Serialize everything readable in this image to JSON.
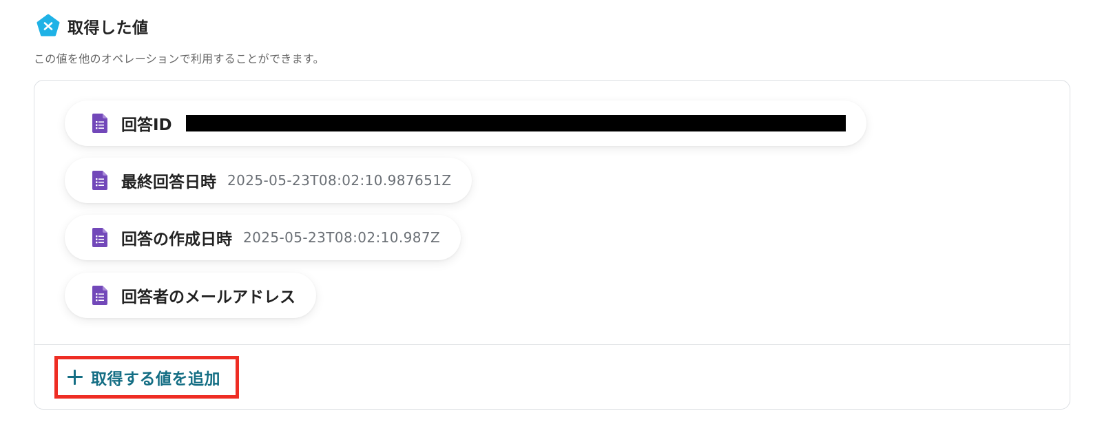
{
  "header": {
    "title": "取得した値",
    "icon": "variable-icon",
    "icon_color": "#1fb2e6"
  },
  "description": "この値を他のオペレーションで利用することができます。",
  "values": [
    {
      "label": "回答ID",
      "value": "",
      "redacted": true,
      "icon": "google-forms-icon"
    },
    {
      "label": "最終回答日時",
      "value": "2025-05-23T08:02:10.987651Z",
      "icon": "google-forms-icon"
    },
    {
      "label": "回答の作成日時",
      "value": "2025-05-23T08:02:10.987Z",
      "icon": "google-forms-icon"
    },
    {
      "label": "回答者のメールアドレス",
      "value": "",
      "icon": "google-forms-icon"
    }
  ],
  "add_button": {
    "label": "取得する値を追加",
    "color": "#146e84",
    "highlight_color": "#ee2d24"
  },
  "forms_icon_color": "#7248b9"
}
